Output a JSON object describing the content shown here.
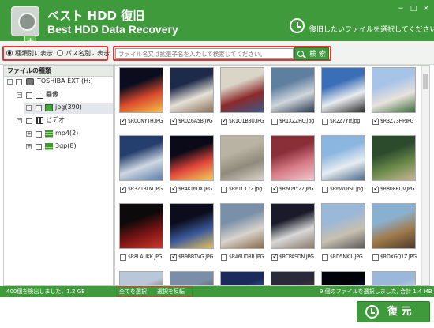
{
  "header": {
    "title_ja": "ベスト HDD 復旧",
    "title_en": "Best HDD Data Recovery",
    "hint": "復旧したいファイルを選択してください",
    "controls": [
      "−",
      "□",
      "×"
    ]
  },
  "view_mode": {
    "by_type": "種類別に表示",
    "by_path": "パス名別に表示",
    "selected": "by_type"
  },
  "search": {
    "placeholder": "ファイル名又は拡張子名を入力して検索してください。",
    "button_label": "検 索"
  },
  "tree": {
    "header": "ファイルの種類",
    "drive": "TOSHIBA EXT (H:)",
    "images": "画像",
    "jpg": "jpg(390)",
    "video": "ビデオ",
    "mp4": "mp4(2)",
    "threegp": "3gp(8)"
  },
  "files": [
    {
      "name": "$R0UNYTH.JPG",
      "checked": true,
      "palette": [
        "#0b0d1e",
        "#d94a2c",
        "#f3c34a"
      ]
    },
    {
      "name": "$R0Z6A5B.JPG",
      "checked": true,
      "palette": [
        "#1d2a4a",
        "#e6e1d6",
        "#8a6f5a"
      ]
    },
    {
      "name": "$R1Q1B8U.JPG",
      "checked": true,
      "palette": [
        "#d9d5c7",
        "#8c2a2a",
        "#3a5a8a"
      ]
    },
    {
      "name": "$R1XZZHO.jpg",
      "checked": false,
      "palette": [
        "#5f7fa0",
        "#d0d6dc",
        "#2a3a50"
      ]
    },
    {
      "name": "$R2Z7YIY.jpg",
      "checked": false,
      "palette": [
        "#3a6fb8",
        "#e9ecef",
        "#2c2c2c"
      ]
    },
    {
      "name": "$R3Z73HP.JPG",
      "checked": true,
      "palette": [
        "#a6c3e8",
        "#e8e2dc",
        "#3c6a3c"
      ]
    },
    {
      "name": "$R3Z13LM.JPG",
      "checked": true,
      "palette": [
        "#243f6e",
        "#cfd7e2",
        "#5a7ea8"
      ]
    },
    {
      "name": "$R4KT6UX.JPG",
      "checked": true,
      "palette": [
        "#0a0a18",
        "#e1463a",
        "#f0d060"
      ]
    },
    {
      "name": "$R61CT72.jpg",
      "checked": false,
      "palette": [
        "#b8b3a2",
        "#8f8a7a",
        "#d8d4c8"
      ]
    },
    {
      "name": "$R6O9Y22.JPG",
      "checked": true,
      "palette": [
        "#8a2e38",
        "#d67a86",
        "#f0c8cc"
      ]
    },
    {
      "name": "$R6WDISL.jpg",
      "checked": false,
      "palette": [
        "#8ab6e0",
        "#e8ecf0",
        "#4a6a8a"
      ]
    },
    {
      "name": "$R808RQV.JPG",
      "checked": true,
      "palette": [
        "#2c4a2c",
        "#6a8a4a",
        "#c8b896"
      ]
    },
    {
      "name": "$R8LAUKK.JPG",
      "checked": false,
      "palette": [
        "#0c0a0a",
        "#7a1414",
        "#c83a2a"
      ]
    },
    {
      "name": "$R9BBTVG.JPG",
      "checked": true,
      "palette": [
        "#0c0c1c",
        "#3a5a9a",
        "#e8c060"
      ]
    },
    {
      "name": "$RA6UD8R.JPG",
      "checked": false,
      "palette": [
        "#7a90a8",
        "#d8d4cc",
        "#8a6a4a"
      ]
    },
    {
      "name": "$RCPASDN.JPG",
      "checked": true,
      "palette": [
        "#1a1a2a",
        "#d8d8d8",
        "#8a7a6a"
      ]
    },
    {
      "name": "$RD5NKIL.JPG",
      "checked": false,
      "palette": [
        "#9ab8d8",
        "#c8c0b0",
        "#5a5a5a"
      ]
    },
    {
      "name": "$RDXGQ1Z.JPG",
      "checked": false,
      "palette": [
        "#8ab0d0",
        "#a07a4a",
        "#4a3a2a"
      ]
    },
    {
      "name": "",
      "checked": false,
      "palette": [
        "#b8c8d8",
        "#6a5a4a",
        "#d8d0c0"
      ]
    },
    {
      "name": "",
      "checked": false,
      "palette": [
        "#7a8ea8",
        "#4a5a4a",
        "#c8c8c0"
      ]
    },
    {
      "name": "",
      "checked": false,
      "palette": [
        "#1a2a5a",
        "#3a6ab0",
        "#c8d8e8"
      ]
    },
    {
      "name": "",
      "checked": false,
      "palette": [
        "#2a2a3a",
        "#5a3a2a",
        "#e0a070"
      ]
    },
    {
      "name": "",
      "checked": false,
      "palette": [
        "#020308",
        "#0a1a50",
        "#3a6ac8"
      ]
    },
    {
      "name": "",
      "checked": false,
      "palette": [
        "#9ab8d8",
        "#e0e4e8",
        "#4a5a6a"
      ]
    }
  ],
  "footer": {
    "detected": "400個を検出しました、1.2 GB",
    "select_all": "全てを選択",
    "invert": "選択を反転",
    "selected_summary": "9 個のファイルを選択しました, 合計 1.4 MB"
  },
  "recover_button": "復 元",
  "colors": {
    "brand": "#3f9a3c",
    "highlight": "#e53535"
  }
}
